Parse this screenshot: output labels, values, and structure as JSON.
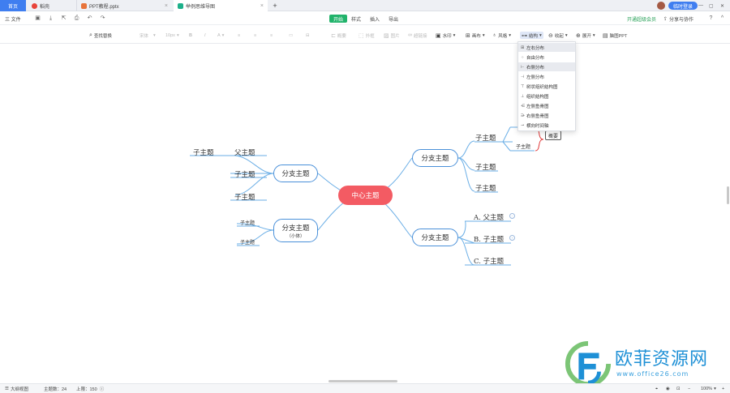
{
  "tabs": {
    "home": "首页",
    "daoke": "稻壳",
    "ppt": "PPT教程.pptx",
    "mindmap": "举例思维导图",
    "add": "+"
  },
  "window": {
    "login": "临时登录"
  },
  "menubar": {
    "file": "三 文件",
    "start": "开始",
    "style": "样式",
    "insert": "插入",
    "export": "导出",
    "vip": "开通超级会员",
    "share": "分享与协作"
  },
  "toolbar": {
    "find_replace": "查找替换",
    "font": "宋体",
    "size": "10px",
    "bold": "B",
    "italic": "I",
    "color": "A",
    "clear": "概要",
    "outer_frame": "外框",
    "image": "图片",
    "hyperlink": "超链接",
    "watermark": "水印",
    "layout": "画布",
    "style": "风格",
    "structure": "结构",
    "collapse": "收起",
    "expand": "展开",
    "ppt": "脑图PPT"
  },
  "structure_menu": {
    "items": [
      {
        "label": "左右分布",
        "icon": "left-right-layout-icon",
        "selected": true
      },
      {
        "label": "自由分布",
        "icon": "free-layout-icon",
        "selected": false
      },
      {
        "label": "右侧分布",
        "icon": "right-layout-icon",
        "selected": true
      },
      {
        "label": "左侧分布",
        "icon": "left-layout-icon",
        "selected": false
      },
      {
        "label": "树状组织结构图",
        "icon": "tree-org-icon",
        "selected": false
      },
      {
        "label": "组织结构图",
        "icon": "org-chart-icon",
        "selected": false
      },
      {
        "label": "左侧鱼骨图",
        "icon": "left-fishbone-icon",
        "selected": false
      },
      {
        "label": "右侧鱼骨图",
        "icon": "right-fishbone-icon",
        "selected": false
      },
      {
        "label": "横向时间轴",
        "icon": "timeline-icon",
        "selected": false
      }
    ]
  },
  "mindmap": {
    "center": "中心主题",
    "branch": "分支主题",
    "branch_note": "（小体）",
    "sub": "子主题",
    "parent": "父主题",
    "summary": "概要",
    "a_parent": "A. 父主题",
    "b_sub": "B. 子主题",
    "c_sub": "C. 子主题"
  },
  "statusbar": {
    "outline": "大纲视图",
    "topic_count": "主题数：24",
    "limit": "上限：150",
    "zoom": "100%"
  },
  "watermark": {
    "title": "欧菲资源网",
    "url": "www.office26.com"
  },
  "colors": {
    "accent": "#3f7ef0",
    "start": "#21b36b",
    "center": "#f35b63",
    "branch_border": "#4a90d9"
  }
}
